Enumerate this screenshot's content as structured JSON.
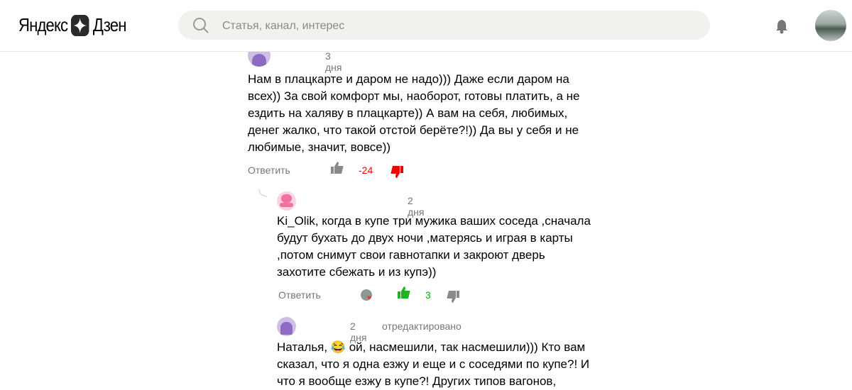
{
  "header": {
    "logo_text_left": "Яндекс",
    "logo_text_right": "Дзен",
    "search_placeholder": "Статья, канал, интерес"
  },
  "comments": [
    {
      "time": "3 дня",
      "text": "Нам в плацкарте и даром не надо))) Даже если даром на всех)) За свой комфорт мы, наоборот, готовы платить, а не ездить на халяву в плацкарте)) А вам на себя, любимых, денег жалко, что такой отстой берёте?!)) Да вы у себя и не любимые, значит, вовсе))",
      "reply_label": "Ответить",
      "score": "-24",
      "score_color": "#ff0000"
    },
    {
      "time": "2 дня",
      "text": "Ki_Olik, когда в купе три мужика ваших соседа ,сначала будут бухать до двух ночи ,матерясь и играя в карты ,потом снимут свои гавнотапки и закроют дверь захотите сбежать и из купэ))",
      "reply_label": "Ответить",
      "score": "3",
      "score_color": "#00b300"
    },
    {
      "time": "2 дня",
      "edited": "отредактировано",
      "text": "Наталья, 😂 ой, насмешили, так насмешили))) Кто вам сказал, что я одна езжу и еще и с соседями по купе?! И что я вообще езжу в купе?! Других типов вагонов,"
    }
  ]
}
